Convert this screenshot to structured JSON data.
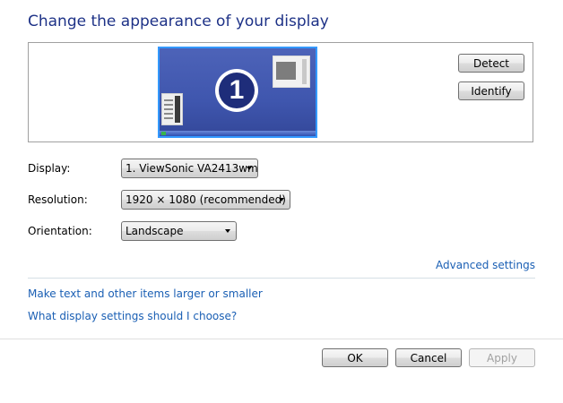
{
  "header": {
    "title": "Change the appearance of your display"
  },
  "preview": {
    "monitor_number": "1",
    "detect_label": "Detect",
    "identify_label": "Identify"
  },
  "settings": {
    "display": {
      "label": "Display:",
      "value": "1. ViewSonic VA2413wm"
    },
    "resolution": {
      "label": "Resolution:",
      "value": "1920 × 1080 (recommended)"
    },
    "orientation": {
      "label": "Orientation:",
      "value": "Landscape"
    }
  },
  "links": {
    "advanced": "Advanced settings",
    "text_size": "Make text and other items larger or smaller",
    "help": "What display settings should I choose?"
  },
  "footer": {
    "ok_label": "OK",
    "cancel_label": "Cancel",
    "apply_label": "Apply"
  },
  "colors": {
    "title": "#1e3287",
    "link": "#1a5fb4",
    "monitor_selection": "#3399ff"
  }
}
